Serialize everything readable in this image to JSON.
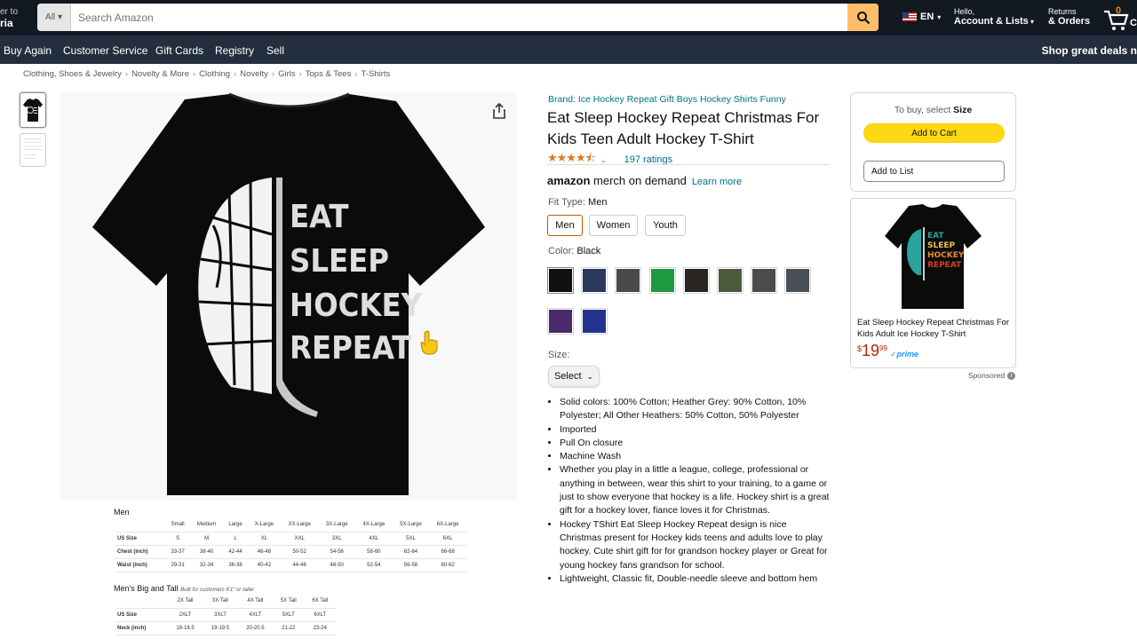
{
  "header": {
    "deliver_line1": "er to",
    "deliver_line2": "ria",
    "search_dept": "All",
    "search_placeholder": "Search Amazon",
    "lang": "EN",
    "account_line1": "Hello,",
    "account_line2": "Account & Lists",
    "orders_line1": "Returns",
    "orders_line2": "& Orders",
    "cart_count": "0",
    "cart_label": "C"
  },
  "nav": {
    "items": [
      "Buy Again",
      "Customer Service",
      "Gift Cards",
      "Registry",
      "Sell"
    ],
    "promo": "Shop great deals n"
  },
  "breadcrumbs": [
    "Clothing, Shoes & Jewelry",
    "Novelty & More",
    "Clothing",
    "Novelty",
    "Girls",
    "Tops & Tees",
    "T-Shirts"
  ],
  "image": {
    "shirt_text": [
      "EAT",
      "SLEEP",
      "HOCKEY",
      "REPEAT"
    ]
  },
  "size_chart": {
    "title": "Men",
    "headers": [
      "",
      "Small",
      "Medium",
      "Large",
      "X-Large",
      "XX-Large",
      "3X-Large",
      "4X-Large",
      "5X-Large",
      "6X-Large"
    ],
    "rows": [
      [
        "US Size",
        "S",
        "M",
        "L",
        "XL",
        "XXL",
        "3XL",
        "4XL",
        "5XL",
        "6XL"
      ],
      [
        "Chest (inch)",
        "33-37",
        "38-40",
        "42-44",
        "46-48",
        "50-52",
        "54-56",
        "58-60",
        "62-64",
        "66-68"
      ],
      [
        "Waist (inch)",
        "29-31",
        "32-34",
        "36-38",
        "40-42",
        "44-46",
        "48-50",
        "52-54",
        "56-58",
        "60-62"
      ]
    ],
    "tall_title": "Men's Big and Tall",
    "tall_note": "Built for customers 6'1\" or taller",
    "tall_headers": [
      "",
      "2X Tall",
      "3X Tall",
      "4X Tall",
      "5X Tall",
      "6X Tall"
    ],
    "tall_rows": [
      [
        "US Size",
        "2XLT",
        "3XLT",
        "4XLT",
        "5XLT",
        "6XLT"
      ],
      [
        "Neck (inch)",
        "18-18.5",
        "19-19.5",
        "20-20.5",
        "21-22",
        "23-24"
      ]
    ]
  },
  "product": {
    "brand": "Brand: Ice Hockey Repeat Gift Boys Hockey Shirts Funny",
    "title": "Eat Sleep Hockey Repeat Christmas For Kids Teen Adult Hockey T-Shirt",
    "stars": "★★★★⯪",
    "stars_value": 4.5,
    "ratings": "197 ratings",
    "merch_logo_a": "amazon",
    "merch_logo_b": "merch on demand",
    "learn_more": "Learn more",
    "fit_label": "Fit Type:",
    "fit_value": "Men",
    "fit_options": [
      "Men",
      "Women",
      "Youth"
    ],
    "color_label": "Color:",
    "color_value": "Black",
    "color_swatches": [
      "#111111",
      "#2b3a5c",
      "#4a4a4a",
      "#1f9a3f",
      "#2b2522",
      "#4e5a3e",
      "#4a4b4c",
      "#4a5058",
      "#4a2a6a",
      "#24348e"
    ],
    "size_label": "Size:",
    "size_select": "Select",
    "bullets": [
      "Solid colors: 100% Cotton; Heather Grey: 90% Cotton, 10% Polyester; All Other Heathers: 50% Cotton, 50% Polyester",
      "Imported",
      "Pull On closure",
      "Machine Wash",
      "Whether you play in a little a league, college, professional or anything in between, wear this shirt to your training, to a game or just to show everyone that hockey is a life. Hockey shirt is a great gift for a hockey lover, fiance loves it for Christmas.",
      "Hockey TShirt Eat Sleep Hockey Repeat design is nice Christmas present for Hockey kids teens and adults love to play hockey. Cute shirt gift for for grandson hockey player or Great for young hockey fans grandson for school.",
      "Lightweight, Classic fit, Double-needle sleeve and bottom hem"
    ]
  },
  "buybox": {
    "to_buy": "To buy, select",
    "to_buy_bold": "Size",
    "add_to_cart": "Add to Cart",
    "add_to_list": "Add to List"
  },
  "ad": {
    "title": "Eat Sleep Hockey Repeat Christmas For Kids Adult Ice Hockey T-Shirt",
    "price_symbol": "$",
    "price_whole": "19",
    "price_fraction": "99",
    "prime": "✓prime",
    "shirt_text": [
      "EAT",
      "SLEEP",
      "HOCKEY",
      "REPEAT"
    ],
    "sponsored": "Sponsored"
  }
}
